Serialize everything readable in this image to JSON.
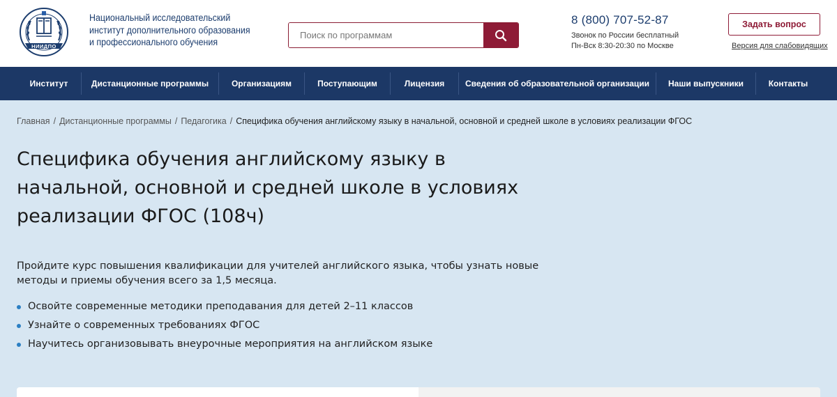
{
  "header": {
    "org_name_lines": [
      "Национальный исследовательский",
      "институт дополнительного образования",
      "и профессионального обучения"
    ],
    "logo_text": "НИИДПО",
    "search_placeholder": "Поиск по программам",
    "phone": "8 (800) 707-52-87",
    "phone_note_1": "Звонок по России бесплатный",
    "phone_note_2": "Пн-Вск 8:30-20:30 по Москве",
    "ask_button": "Задать вопрос",
    "vision_link": "Версия для слабовидящих"
  },
  "nav": {
    "items": [
      "Институт",
      "Дистанционные программы",
      "Организациям",
      "Поступающим",
      "Лицензия",
      "Сведения об образовательной организации",
      "Наши выпускники",
      "Контакты"
    ]
  },
  "breadcrumb": {
    "items": [
      "Главная",
      "Дистанционные программы",
      "Педагогика"
    ],
    "current": "Специфика обучения английскому языку в начальной, основной и средней школе в условиях реализации ФГОС"
  },
  "page": {
    "title_lines": [
      "Специфика обучения английскому языку в",
      "начальной, основной и средней школе в условиях",
      "реализации ФГОС (108ч)"
    ],
    "lead": "Пройдите курс повышения квалификации для учителей английского языка, чтобы узнать новые методы и приемы обучения всего за 1,5 месяца.",
    "bullets": [
      "Освойте современные методики преподавания для детей 2–11 классов",
      "Узнайте о современных требованиях ФГОС",
      "Научитесь организовывать внеурочные мероприятия на английском языке"
    ]
  },
  "colors": {
    "brand_blue": "#1c3866",
    "accent_red": "#8e1b36",
    "page_bg": "#d7e6f2",
    "bullet_blue": "#2b7fc3"
  }
}
